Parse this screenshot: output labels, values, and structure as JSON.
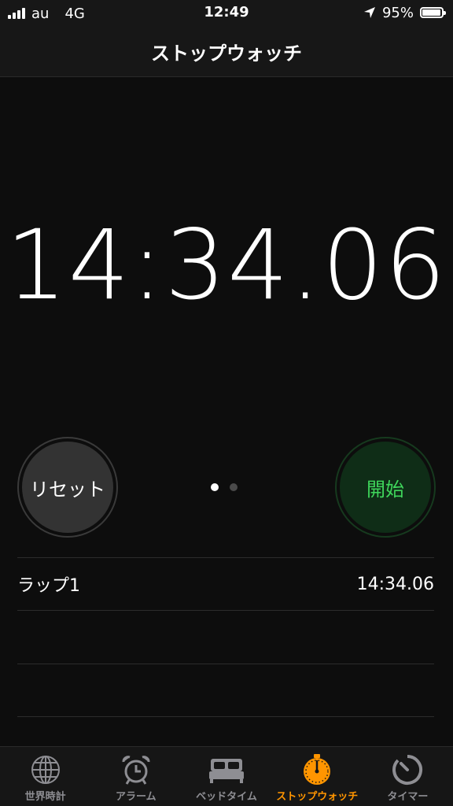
{
  "status_bar": {
    "carrier": "au",
    "network": "4G",
    "time": "12:49",
    "battery": "95%",
    "battery_level": 0.95
  },
  "nav": {
    "title": "ストップウォッチ"
  },
  "timer": {
    "display": "14:34.06"
  },
  "controls": {
    "reset_label": "リセット",
    "start_label": "開始",
    "page_count": 2,
    "active_page": 0
  },
  "laps": [
    {
      "label": "ラップ1",
      "time": "14:34.06"
    }
  ],
  "tabs": [
    {
      "label": "世界時計",
      "icon": "globe-icon",
      "active": false
    },
    {
      "label": "アラーム",
      "icon": "alarm-clock-icon",
      "active": false
    },
    {
      "label": "ベッドタイム",
      "icon": "bed-icon",
      "active": false
    },
    {
      "label": "ストップウォッチ",
      "icon": "stopwatch-icon",
      "active": true
    },
    {
      "label": "タイマー",
      "icon": "timer-icon",
      "active": false
    }
  ],
  "colors": {
    "accent": "#ff9500",
    "start_text": "#3fd65b",
    "start_bg": "#0f2d17",
    "reset_bg": "#333333"
  }
}
